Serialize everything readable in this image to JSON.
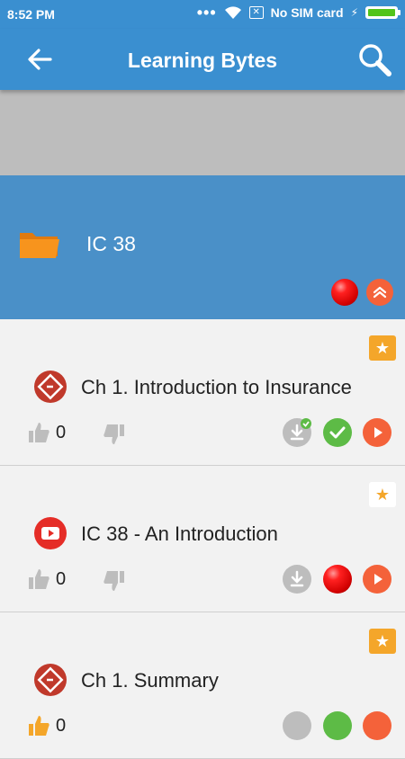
{
  "status_bar": {
    "time": "8:52 PM",
    "sim_text": "No SIM card"
  },
  "app_bar": {
    "title": "Learning Bytes",
    "back_icon": "arrow-left-icon",
    "search_icon": "search-icon"
  },
  "folder": {
    "title": "IC 38",
    "icon": "folder-icon"
  },
  "items": [
    {
      "title": "Ch 1. Introduction to Insurance",
      "likes": "0",
      "type": "ebook",
      "starred": true,
      "status": "completed"
    },
    {
      "title": "IC 38 - An Introduction",
      "likes": "0",
      "type": "video",
      "starred": false,
      "status": "not-started"
    },
    {
      "title": "Ch 1. Summary",
      "likes": "0",
      "type": "ebook",
      "starred": true,
      "status": "completed"
    }
  ],
  "colors": {
    "primary": "#3a8fd0",
    "folder_bg": "#4a90c8",
    "accent_orange": "#f4623a",
    "star": "#f4a62a",
    "done_green": "#5dbb46"
  }
}
